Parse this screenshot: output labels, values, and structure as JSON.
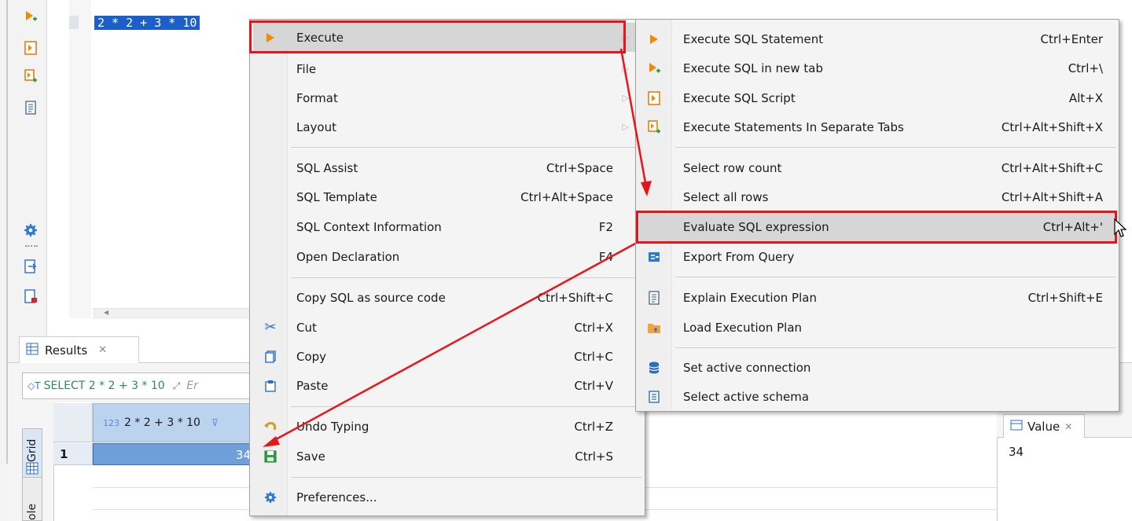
{
  "editor": {
    "code": "2 * 2 + 3 * 10"
  },
  "left_toolbar": {
    "icons": [
      "execute-new-tab-icon",
      "execute-script-icon",
      "execute-separate-tabs-icon",
      "explain-plan-icon",
      "settings-icon",
      "export-icon",
      "new-script-icon"
    ]
  },
  "results": {
    "tab_label": "Results",
    "query_text": "SELECT 2 * 2 + 3 * 10",
    "query_hint": "Er",
    "side_tab_grid": "Grid",
    "side_tab_text": "ole",
    "column_header": "2 * 2 + 3 * 10",
    "column_type_badge": "123",
    "rows": [
      {
        "num": "1",
        "value": "34"
      }
    ],
    "value_panel_title": "Value",
    "value_panel_content": "34"
  },
  "context_menu": {
    "items": [
      {
        "label": "Execute",
        "shortcut": "",
        "submenu": true,
        "icon": "execute-icon"
      },
      {
        "label": "File",
        "shortcut": "",
        "submenu": true,
        "icon": ""
      },
      {
        "label": "Format",
        "shortcut": "",
        "submenu": true,
        "icon": ""
      },
      {
        "label": "Layout",
        "shortcut": "",
        "submenu": true,
        "icon": ""
      },
      {
        "label": "SQL Assist",
        "shortcut": "Ctrl+Space",
        "icon": ""
      },
      {
        "label": "SQL Template",
        "shortcut": "Ctrl+Alt+Space",
        "icon": ""
      },
      {
        "label": "SQL Context Information",
        "shortcut": "F2",
        "icon": ""
      },
      {
        "label": "Open Declaration",
        "shortcut": "F4",
        "icon": ""
      },
      {
        "label": "Copy SQL as source code",
        "shortcut": "Ctrl+Shift+C",
        "icon": ""
      },
      {
        "label": "Cut",
        "shortcut": "Ctrl+X",
        "icon": "scissors-icon"
      },
      {
        "label": "Copy",
        "shortcut": "Ctrl+C",
        "icon": "copy-icon"
      },
      {
        "label": "Paste",
        "shortcut": "Ctrl+V",
        "icon": "paste-icon"
      },
      {
        "label": "Undo Typing",
        "shortcut": "Ctrl+Z",
        "icon": "undo-icon"
      },
      {
        "label": "Save",
        "shortcut": "Ctrl+S",
        "icon": "save-icon"
      },
      {
        "label": "Preferences...",
        "shortcut": "",
        "icon": "gear-icon"
      }
    ]
  },
  "execute_submenu": {
    "items": [
      {
        "label": "Execute SQL Statement",
        "shortcut": "Ctrl+Enter",
        "icon": "execute-icon"
      },
      {
        "label": "Execute SQL in new tab",
        "shortcut": "Ctrl+\\",
        "icon": "execute-new-tab-icon"
      },
      {
        "label": "Execute SQL Script",
        "shortcut": "Alt+X",
        "icon": "execute-script-icon"
      },
      {
        "label": "Execute Statements In Separate Tabs",
        "shortcut": "Ctrl+Alt+Shift+X",
        "icon": "execute-separate-tabs-icon"
      },
      {
        "label": "Select row count",
        "shortcut": "Ctrl+Alt+Shift+C",
        "icon": ""
      },
      {
        "label": "Select all rows",
        "shortcut": "Ctrl+Alt+Shift+A",
        "icon": ""
      },
      {
        "label": "Evaluate SQL expression",
        "shortcut": "Ctrl+Alt+'",
        "icon": ""
      },
      {
        "label": "Export From Query",
        "shortcut": "",
        "icon": "export-icon"
      },
      {
        "label": "Explain Execution Plan",
        "shortcut": "Ctrl+Shift+E",
        "icon": "explain-plan-icon"
      },
      {
        "label": "Load Execution Plan",
        "shortcut": "",
        "icon": "folder-icon"
      },
      {
        "label": "Set active connection",
        "shortcut": "",
        "icon": "database-icon"
      },
      {
        "label": "Select active schema",
        "shortcut": "",
        "icon": "schema-icon"
      }
    ]
  },
  "colors": {
    "highlight_red": "#e8141a",
    "selection_blue": "#1c5fc9",
    "execute_orange": "#f08a00",
    "menu_bg": "#f4f4f4"
  }
}
